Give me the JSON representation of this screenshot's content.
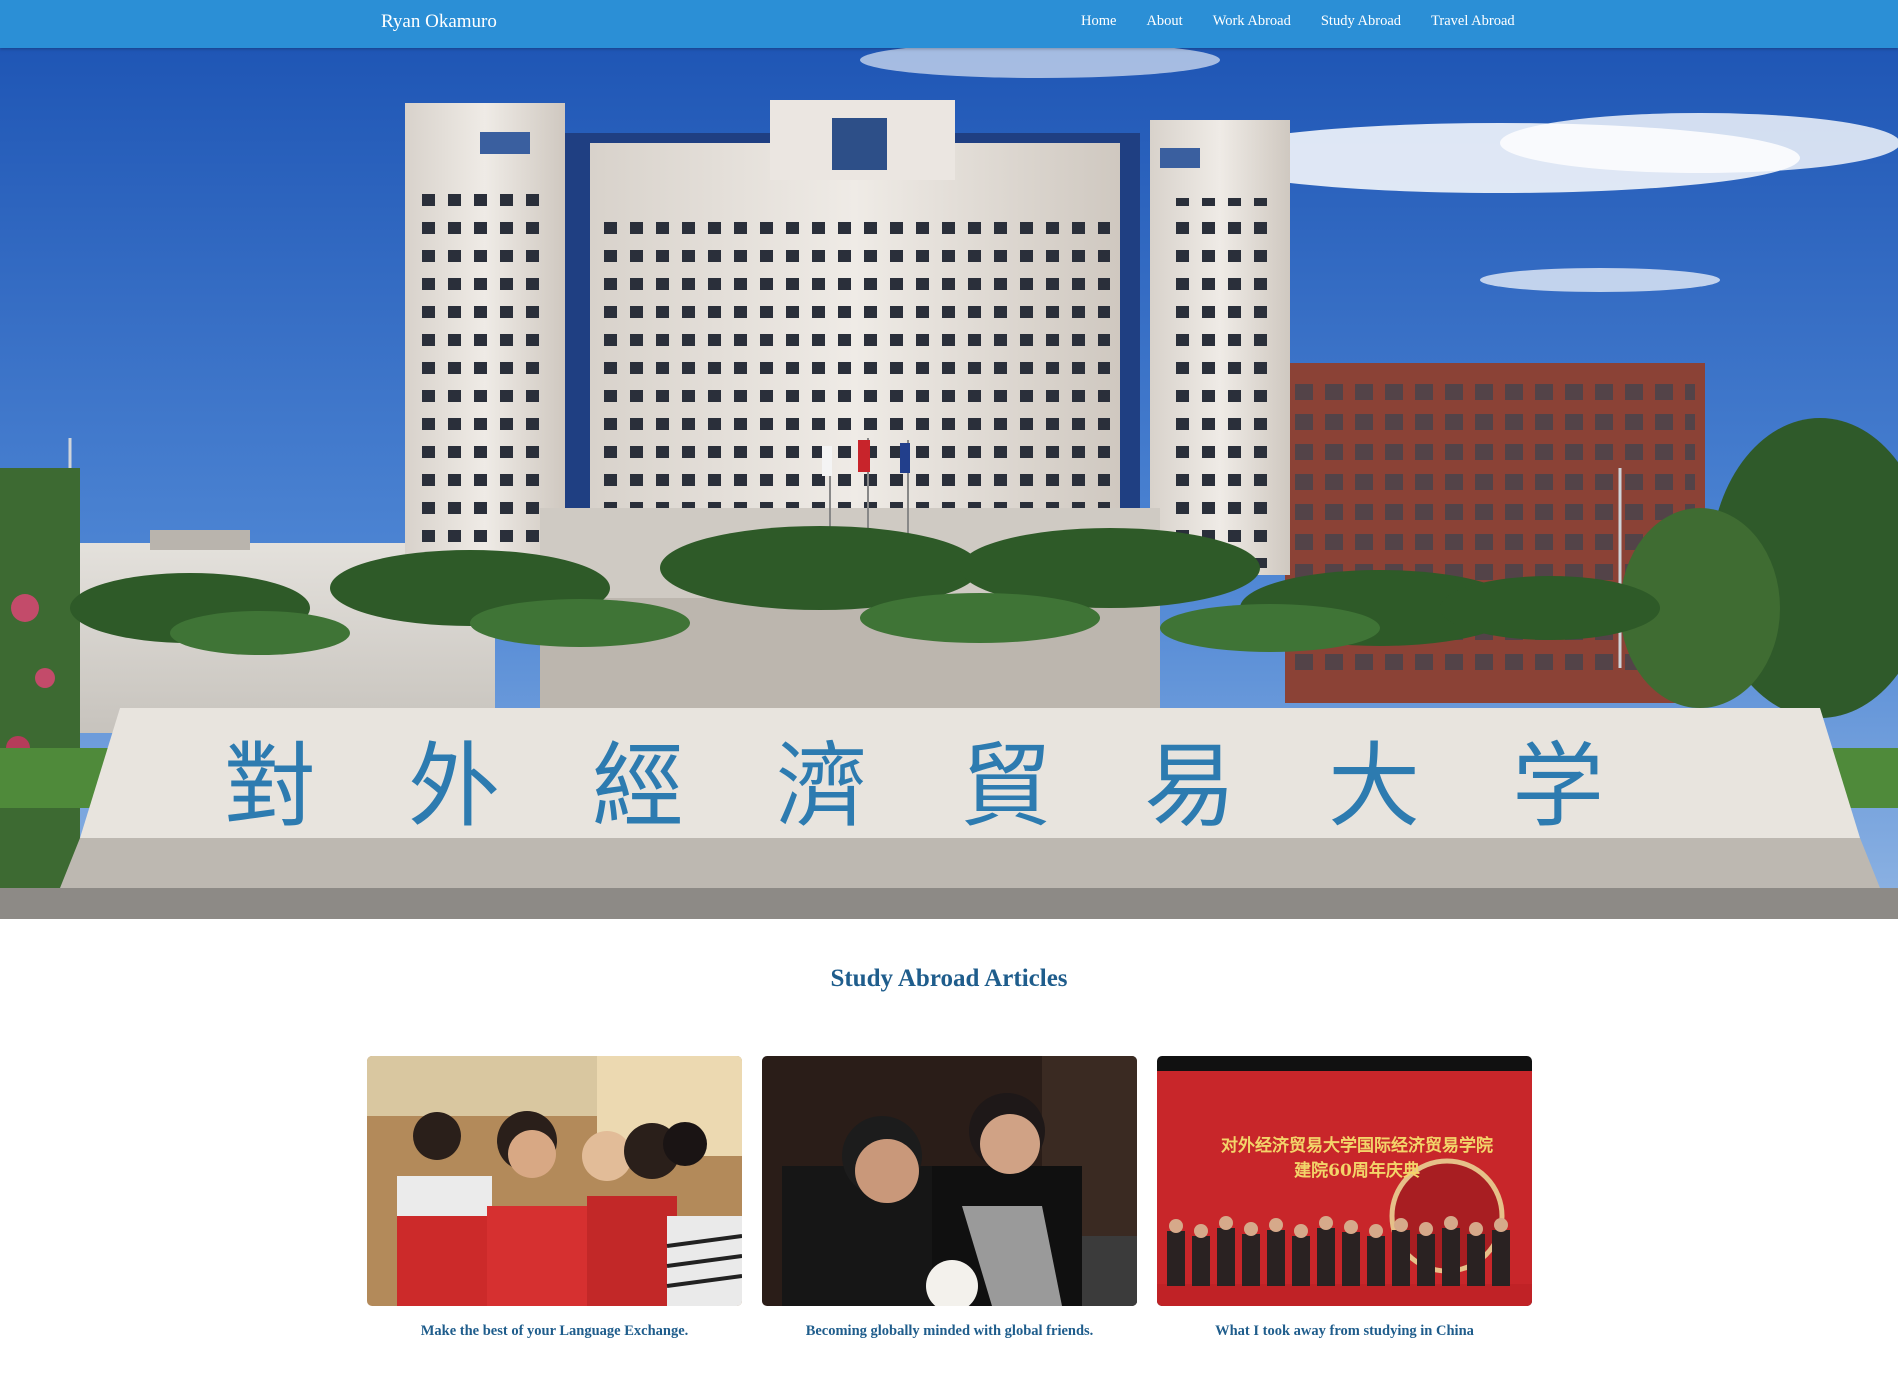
{
  "brand": "Ryan Okamuro",
  "nav": {
    "items": [
      {
        "label": "Home"
      },
      {
        "label": "About"
      },
      {
        "label": "Work Abroad"
      },
      {
        "label": "Study Abroad"
      },
      {
        "label": "Travel Abroad"
      }
    ]
  },
  "hero": {
    "sign_text": "對外經濟貿易大学"
  },
  "section": {
    "title": "Study Abroad Articles"
  },
  "articles": [
    {
      "caption": "Make the best of your Language Exchange."
    },
    {
      "caption": "Becoming globally minded with global friends."
    },
    {
      "caption": "What I took away from studying in China",
      "banner_text_1": "对外经济贸易大学国际经济贸易学院",
      "banner_text_2": "建院60周年庆典"
    }
  ],
  "colors": {
    "navbar": "#2b8fd6",
    "heading": "#1f5d8c"
  }
}
